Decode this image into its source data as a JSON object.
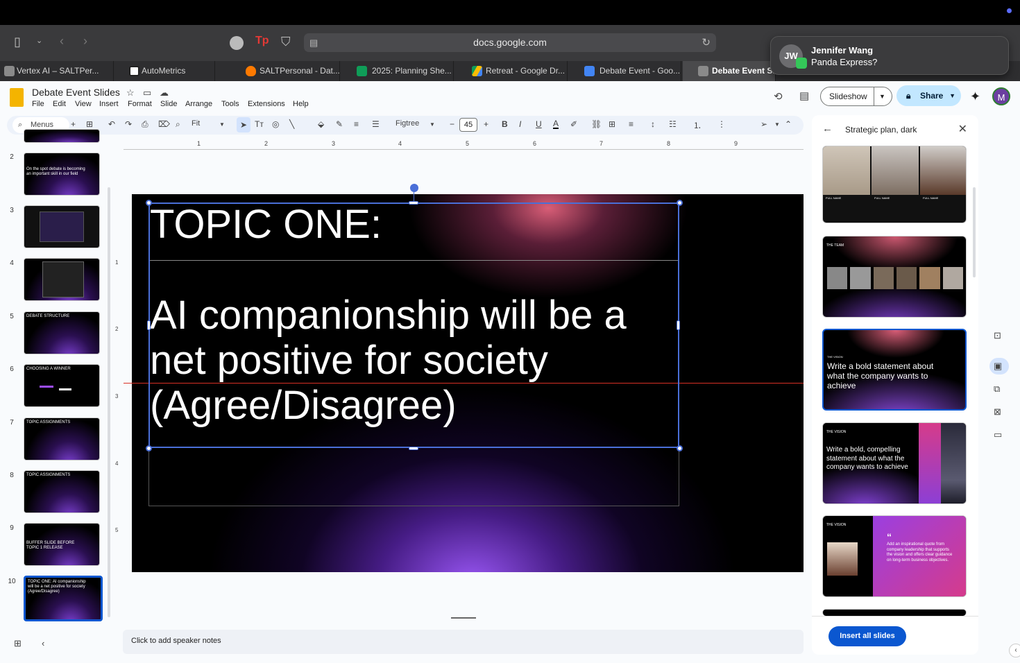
{
  "browser": {
    "url": "docs.google.com",
    "tabs": [
      {
        "label": "Vertex AI – SALTPer...",
        "color": "#8a8a8a"
      },
      {
        "label": "AutoMetrics",
        "color": "#ffffff"
      },
      {
        "label": "SALTPersonal - Dat...",
        "color": "#ff7a00"
      },
      {
        "label": "2025: Planning She...",
        "color": "#0f9d58"
      },
      {
        "label": "Retreat - Google Dr...",
        "color": "#fbbc04"
      },
      {
        "label": "Debate Event - Goo...",
        "color": "#4285f4"
      },
      {
        "label": "Debate Event Slid",
        "color": "#8a8a8a"
      }
    ]
  },
  "notification": {
    "initials": "JW",
    "name": "Jennifer Wang",
    "message": "Panda Express?"
  },
  "app": {
    "title": "Debate Event Slides",
    "menu": [
      "File",
      "Edit",
      "View",
      "Insert",
      "Format",
      "Slide",
      "Arrange",
      "Tools",
      "Extensions",
      "Help"
    ],
    "slideshow_label": "Slideshow",
    "share_label": "Share",
    "avatar_initial": "M"
  },
  "toolbar": {
    "search_label": "Menus",
    "zoom_label": "Fit",
    "font_name": "Figtree",
    "font_size": "45",
    "bold": "B",
    "italic": "I",
    "underline": "U",
    "text_color": "A"
  },
  "ruler": {
    "h_labels": [
      "1",
      "2",
      "3",
      "4",
      "5",
      "6",
      "7",
      "8",
      "9"
    ],
    "v_labels": [
      "1",
      "2",
      "3",
      "4",
      "5"
    ]
  },
  "filmstrip": [
    {
      "num": "2",
      "text": "On the spot debate is becoming an important skill in our field"
    },
    {
      "num": "3",
      "text": ""
    },
    {
      "num": "4",
      "text": ""
    },
    {
      "num": "5",
      "text": "DEBATE STRUCTURE"
    },
    {
      "num": "6",
      "text": "CHOOSING A WINNER"
    },
    {
      "num": "7",
      "text": "TOPIC ASSIGNMENTS"
    },
    {
      "num": "8",
      "text": "TOPIC ASSIGNMENTS"
    },
    {
      "num": "9",
      "text": "BUFFER SLIDE BEFORE TOPIC 1 RELEASE"
    },
    {
      "num": "10",
      "text": "TOPIC ONE: AI companionship will be a net positive for society (Agree/Disagree)"
    }
  ],
  "slide": {
    "title": "TOPIC ONE:",
    "body": "AI companionship will be a net positive for society (Agree/Disagree)"
  },
  "notes": {
    "placeholder": "Click to add speaker notes"
  },
  "panel": {
    "title": "Strategic plan, dark",
    "insert_label": "Insert all slides",
    "templates": [
      {
        "kind": "people3",
        "labels": [
          "FULL NAME",
          "FULL NAME",
          "FULL NAME"
        ]
      },
      {
        "kind": "team",
        "heading": "THE TEAM"
      },
      {
        "kind": "vision",
        "heading": "THE VISION",
        "text": "Write a bold statement about what the company wants to achieve"
      },
      {
        "kind": "vision2",
        "heading": "THE VISION",
        "text": "Write a bold, compelling statement about what the company wants to achieve"
      },
      {
        "kind": "quote",
        "heading": "THE VISION",
        "text": "Add an inspirational quote from company leadership that supports the vision and offers clear guidance on long-term business objectives."
      }
    ]
  }
}
